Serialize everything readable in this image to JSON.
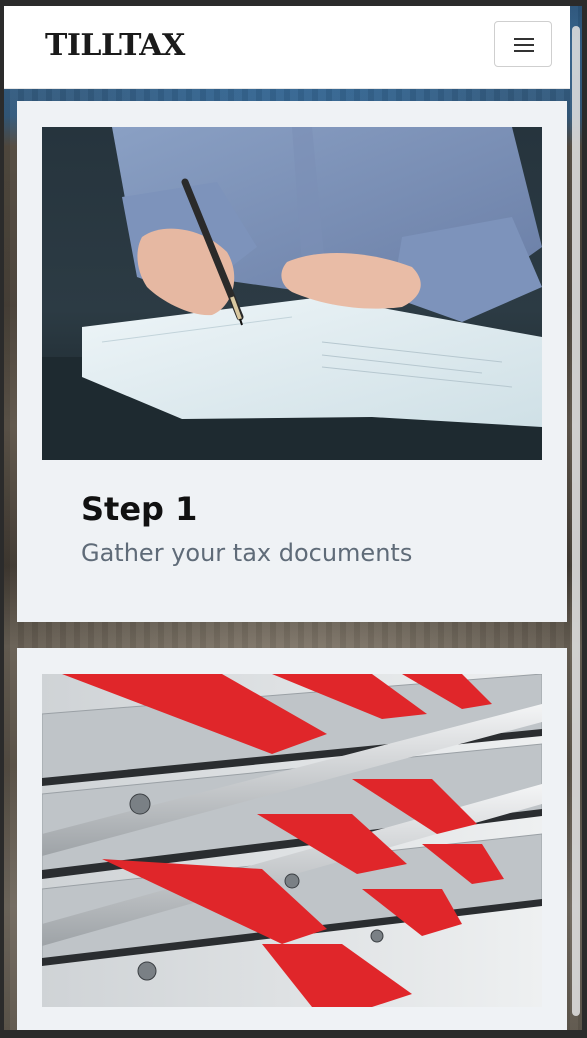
{
  "navbar": {
    "brand": "TillTax",
    "menu_icon": "hamburger-menu-icon"
  },
  "steps": [
    {
      "title": "Step 1",
      "description": "Gather your tax documents",
      "image_icon": "person-signing-document-image"
    },
    {
      "image_icon": "red-envelopes-in-mailboxes-image"
    }
  ],
  "colors": {
    "navbar_bg": "#ffffff",
    "card_bg": "#eff2f5",
    "title_text": "#111111",
    "description_text": "#5f6b78",
    "envelope_red": "#e0262a"
  }
}
